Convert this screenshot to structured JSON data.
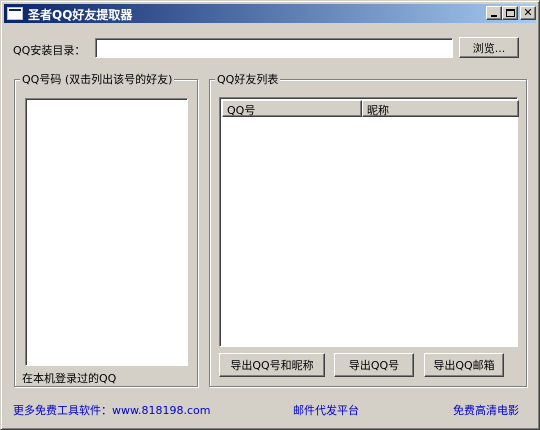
{
  "window": {
    "title": "圣者QQ好友提取器"
  },
  "install": {
    "label": "QQ安装目录：",
    "value": "",
    "browse_label": "浏览..."
  },
  "left_group": {
    "title": "QQ号码 (双击列出该号的好友)",
    "hint": "在本机登录过的QQ",
    "items": []
  },
  "right_group": {
    "title": "QQ好友列表",
    "columns": [
      "QQ号",
      "昵称"
    ],
    "rows": [],
    "buttons": {
      "export_qq_nick": "导出QQ号和昵称",
      "export_qq": "导出QQ号",
      "export_mail": "导出QQ邮箱"
    }
  },
  "footer": {
    "more_tools": "更多免费工具软件：www.818198.com",
    "mail_platform": "邮件代发平台",
    "free_movies": "免费高清电影"
  },
  "icons": {
    "app": "app-window-icon",
    "minimize": "minimize-icon",
    "maximize": "maximize-icon",
    "close": "close-icon"
  },
  "colors": {
    "titlebar_start": "#0a246a",
    "titlebar_end": "#a6caf0",
    "face": "#d4d0c8",
    "link": "#0000cc"
  }
}
